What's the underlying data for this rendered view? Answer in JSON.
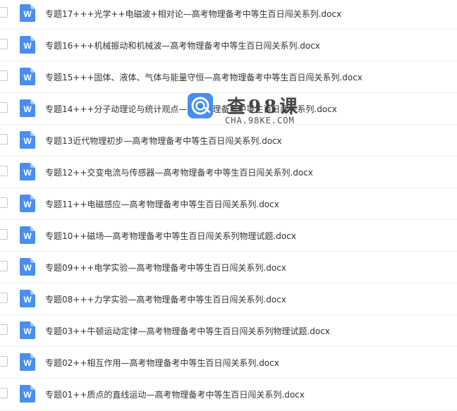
{
  "files": [
    {
      "name": "专题17+++光学++电磁波+相对论—高考物理备考中等生百日闯关系列.docx",
      "icon": "word-doc-icon"
    },
    {
      "name": "专题16+++机械振动和机械波—高考物理备考中等生百日闯关系列.docx",
      "icon": "word-doc-icon"
    },
    {
      "name": "专题15+++固体、液体、气体与能量守恒—高考物理备考中等生百日闯关系列.docx",
      "icon": "word-doc-icon"
    },
    {
      "name": "专题14+++分子动理论与统计观点—高考物理备考中等生百日闯关系列.docx",
      "icon": "word-doc-icon"
    },
    {
      "name": "专题13近代物理初步—高考物理备考中等生百日闯关系列.docx",
      "icon": "word-doc-icon"
    },
    {
      "name": "专题12++交变电流与传感器—高考物理备考中等生百日闯关系列.docx",
      "icon": "word-doc-icon"
    },
    {
      "name": "专题11++电磁感应—高考物理备考中等生百日闯关系列.docx",
      "icon": "word-doc-icon"
    },
    {
      "name": "专题10++磁场—高考物理备考中等生百日闯关系列物理试题.docx",
      "icon": "word-doc-icon"
    },
    {
      "name": "专题09+++电学实验—高考物理备考中等生百日闯关系列.docx",
      "icon": "word-doc-icon"
    },
    {
      "name": "专题08+++力学实验—高考物理备考中等生百日闯关系列.docx",
      "icon": "word-doc-icon"
    },
    {
      "name": "专题03++牛顿运动定律—高考物理备考中等生百日闯关系列物理试题.docx",
      "icon": "word-doc-icon"
    },
    {
      "name": "专题02++相互作用—高考物理备考中等生百日闯关系列.docx",
      "icon": "word-doc-icon"
    },
    {
      "name": "专题01++质点的直线运动—高考物理备考中等生百日闯关系列.docx",
      "icon": "word-doc-icon"
    }
  ],
  "icon_letter": "W",
  "watermark": {
    "title": "查98课",
    "url": "CHA.98KE.COM"
  },
  "colors": {
    "word_icon": "#4a8ef0",
    "text": "#333333",
    "watermark_logo": "#3a86f2"
  }
}
